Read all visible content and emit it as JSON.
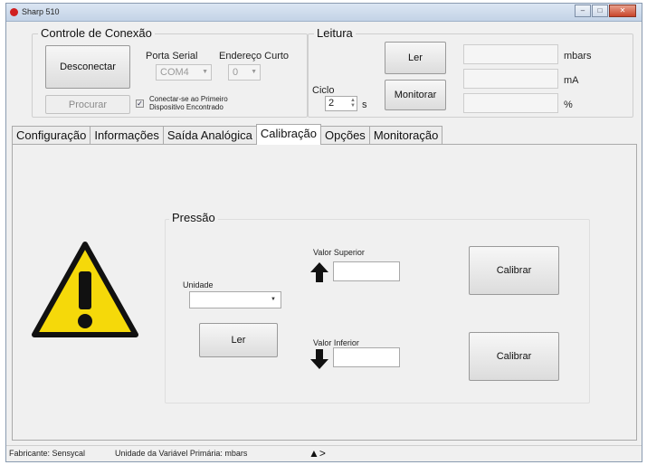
{
  "window": {
    "title": "Sharp 510"
  },
  "connection": {
    "legend": "Controle de Conexão",
    "disconnect_label": "Desconectar",
    "search_label": "Procurar",
    "serial_port_label": "Porta Serial",
    "serial_port_value": "COM4",
    "short_address_label": "Endereço Curto",
    "short_address_value": "0",
    "auto_connect_label_line1": "Conectar-se ao Primeiro",
    "auto_connect_label_line2": "Dispositivo Encontrado"
  },
  "reading": {
    "legend": "Leitura",
    "read_label": "Ler",
    "monitor_label": "Monitorar",
    "cycle_label": "Ciclo",
    "cycle_value": "2",
    "cycle_unit": "s",
    "unit_mbars": "mbars",
    "unit_ma": "mA",
    "unit_percent": "%"
  },
  "tabs": [
    {
      "label": "Configuração"
    },
    {
      "label": "Informações"
    },
    {
      "label": "Saída Analógica"
    },
    {
      "label": "Calibração"
    },
    {
      "label": "Opções"
    },
    {
      "label": "Monitoração"
    }
  ],
  "active_tab": "Calibração",
  "pressure": {
    "legend": "Pressão",
    "unit_label": "Unidade",
    "read_label": "Ler",
    "upper_label": "Valor Superior",
    "lower_label": "Valor Inferior",
    "calibrate_upper_label": "Calibrar",
    "calibrate_lower_label": "Calibrar"
  },
  "status": {
    "manufacturer": "Fabricante: Sensycal",
    "primary_unit": "Unidade da Variável Primária: mbars"
  },
  "colors": {
    "warning_yellow": "#f5d90a",
    "accent": "#4a6fa5"
  }
}
